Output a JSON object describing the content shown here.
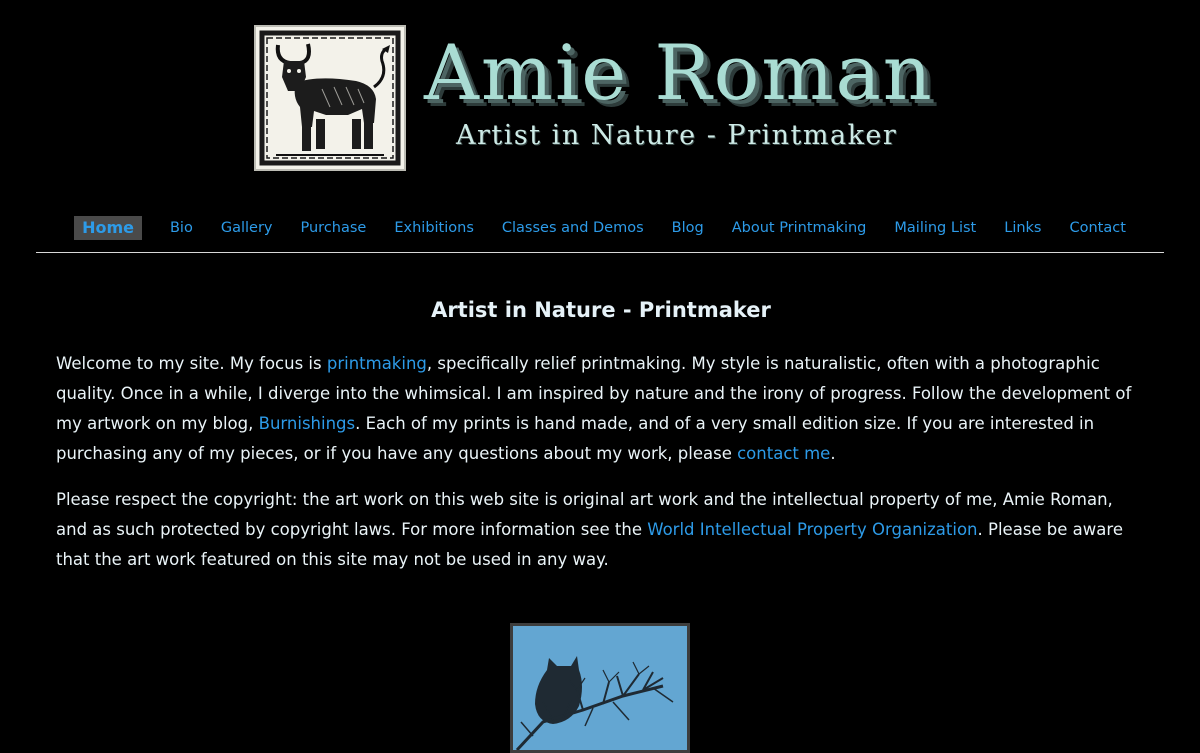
{
  "header": {
    "title": "Amie Roman",
    "tagline": "Artist in Nature - Printmaker",
    "logo_icon": "bull-woodcut-icon"
  },
  "nav": {
    "items": [
      {
        "label": "Home",
        "active": true
      },
      {
        "label": "Bio"
      },
      {
        "label": "Gallery"
      },
      {
        "label": "Purchase"
      },
      {
        "label": "Exhibitions"
      },
      {
        "label": "Classes and Demos"
      },
      {
        "label": "Blog"
      },
      {
        "label": "About Printmaking"
      },
      {
        "label": "Mailing List"
      },
      {
        "label": "Links"
      },
      {
        "label": "Contact"
      }
    ]
  },
  "main": {
    "heading": "Artist in Nature - Printmaker",
    "intro": {
      "t1": "Welcome to my site.  My focus is ",
      "link1": "printmaking",
      "t2": ", specifically relief printmaking.  My style is naturalistic, often with a photographic quality.  Once in a while, I diverge into the whimsical.  I am inspired by nature and the irony of progress.  Follow the development of my artwork on my blog, ",
      "link2": "Burnishings",
      "t3": ".  Each of my prints is hand made, and of a very small edition size.  If you are interested in purchasing any of my pieces, or if you have any questions about my work, please ",
      "link3": "contact me",
      "t4": "."
    },
    "copyright": {
      "t1": "Please respect the copyright: the art work on this web site is original art work and the intellectual property of me, Amie Roman, and as such protected by copyright laws. For more information see the ",
      "link": "World Intellectual Property Organization",
      "t2": ". Please be aware that the art work featured on this site may not be used in any way."
    },
    "featured_image_icon": "owl-on-branch-print-icon"
  },
  "colors": {
    "background": "#000000",
    "link": "#2d9be8",
    "text": "#eaf4f8",
    "title_teal": "#a9dcd3",
    "nav_active_bg": "#4a4a4a",
    "print_blue": "#63a6d2"
  }
}
